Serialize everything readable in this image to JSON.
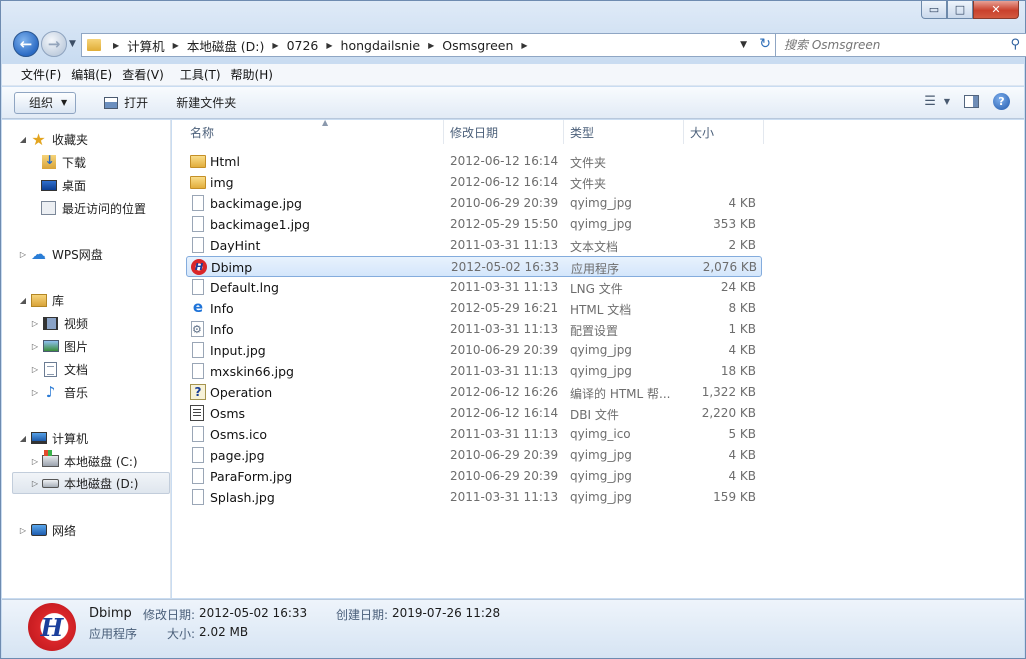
{
  "window": {
    "caption": {
      "minimize": "▭",
      "maximize": "□",
      "close": "✕"
    }
  },
  "nav": {
    "back_symbol": "←",
    "forward_symbol": "→",
    "breadcrumb": [
      "计算机",
      "本地磁盘 (D:)",
      "0726",
      "hongdailsnie",
      "Osmsgreen"
    ],
    "search_placeholder": "搜索 Osmsgreen"
  },
  "menu": [
    "文件(F)",
    "编辑(E)",
    "查看(V)",
    "工具(T)",
    "帮助(H)"
  ],
  "toolbar": {
    "organize": "组织",
    "open": "打开",
    "new_folder": "新建文件夹"
  },
  "navpane": {
    "favorites": "收藏夹",
    "downloads": "下载",
    "desktop": "桌面",
    "recent": "最近访问的位置",
    "wps": "WPS网盘",
    "libraries": "库",
    "videos": "视频",
    "pictures": "图片",
    "documents": "文档",
    "music": "音乐",
    "computer": "计算机",
    "drive_c": "本地磁盘 (C:)",
    "drive_d": "本地磁盘 (D:)",
    "network": "网络"
  },
  "columns": {
    "name": "名称",
    "date": "修改日期",
    "type": "类型",
    "size": "大小"
  },
  "files": [
    {
      "name": "Html",
      "date": "2012-06-12 16:14",
      "type": "文件夹",
      "size": "",
      "icon": "folder"
    },
    {
      "name": "img",
      "date": "2012-06-12 16:14",
      "type": "文件夹",
      "size": "",
      "icon": "folder"
    },
    {
      "name": "backimage.jpg",
      "date": "2010-06-29 20:39",
      "type": "qyimg_jpg",
      "size": "4 KB",
      "icon": "file"
    },
    {
      "name": "backimage1.jpg",
      "date": "2012-05-29 15:50",
      "type": "qyimg_jpg",
      "size": "353 KB",
      "icon": "file"
    },
    {
      "name": "DayHint",
      "date": "2011-03-31 11:13",
      "type": "文本文档",
      "size": "2 KB",
      "icon": "file"
    },
    {
      "name": "Dbimp",
      "date": "2012-05-02 16:33",
      "type": "应用程序",
      "size": "2,076 KB",
      "icon": "exe"
    },
    {
      "name": "Default.lng",
      "date": "2011-03-31 11:13",
      "type": "LNG 文件",
      "size": "24 KB",
      "icon": "file"
    },
    {
      "name": "Info",
      "date": "2012-05-29 16:21",
      "type": "HTML 文档",
      "size": "8 KB",
      "icon": "ie"
    },
    {
      "name": "Info",
      "date": "2011-03-31 11:13",
      "type": "配置设置",
      "size": "1 KB",
      "icon": "ini"
    },
    {
      "name": "Input.jpg",
      "date": "2010-06-29 20:39",
      "type": "qyimg_jpg",
      "size": "4 KB",
      "icon": "file"
    },
    {
      "name": "mxskin66.jpg",
      "date": "2011-03-31 11:13",
      "type": "qyimg_jpg",
      "size": "18 KB",
      "icon": "file"
    },
    {
      "name": "Operation",
      "date": "2012-06-12 16:26",
      "type": "编译的 HTML 帮...",
      "size": "1,322 KB",
      "icon": "chm"
    },
    {
      "name": "Osms",
      "date": "2012-06-12 16:14",
      "type": "DBI 文件",
      "size": "2,220 KB",
      "icon": "dbi"
    },
    {
      "name": "Osms.ico",
      "date": "2011-03-31 11:13",
      "type": "qyimg_ico",
      "size": "5 KB",
      "icon": "file"
    },
    {
      "name": "page.jpg",
      "date": "2010-06-29 20:39",
      "type": "qyimg_jpg",
      "size": "4 KB",
      "icon": "file"
    },
    {
      "name": "ParaForm.jpg",
      "date": "2010-06-29 20:39",
      "type": "qyimg_jpg",
      "size": "4 KB",
      "icon": "file"
    },
    {
      "name": "Splash.jpg",
      "date": "2011-03-31 11:13",
      "type": "qyimg_jpg",
      "size": "159 KB",
      "icon": "file"
    }
  ],
  "details": {
    "name": "Dbimp",
    "kind": "应用程序",
    "modified_label": "修改日期:",
    "modified_value": "2012-05-02 16:33",
    "size_label": "大小:",
    "size_value": "2.02 MB",
    "created_label": "创建日期:",
    "created_value": "2019-07-26 11:28",
    "icon_letter": "H"
  }
}
